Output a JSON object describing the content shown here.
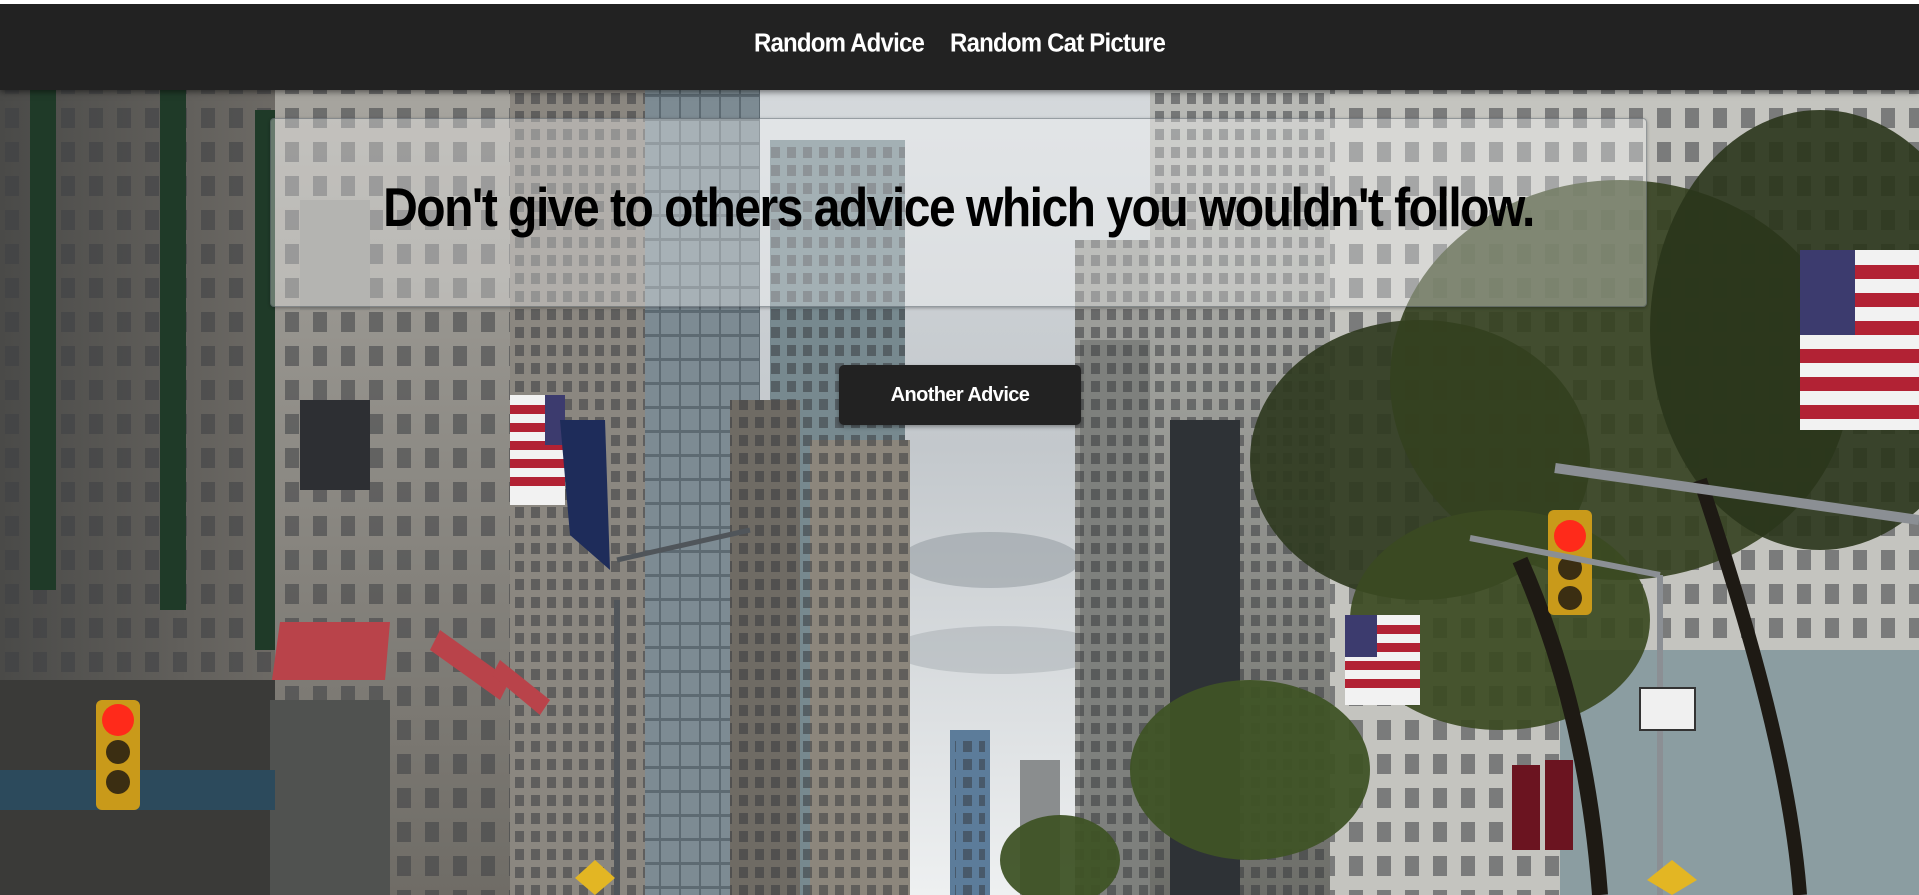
{
  "nav": {
    "links": [
      {
        "label": "Random Advice"
      },
      {
        "label": "Random Cat Picture"
      }
    ],
    "background": "#222222"
  },
  "advice": {
    "text": "Don't give to others advice which you wouldn't follow."
  },
  "button": {
    "label": "Another Advice",
    "background": "#222222"
  },
  "background_image": {
    "icon": "city-street-photo"
  }
}
